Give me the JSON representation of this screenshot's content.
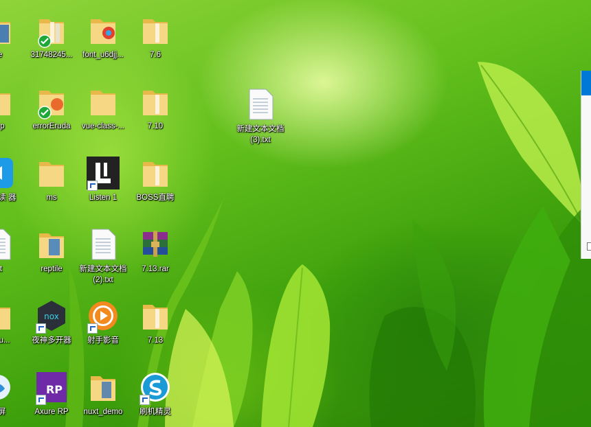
{
  "desktop": {
    "icons": [
      {
        "label": "de",
        "type": "folder-partial"
      },
      {
        "label": "31748245...",
        "type": "folder"
      },
      {
        "label": "font_u6djj...",
        "type": "folder"
      },
      {
        "label": "7.6",
        "type": "folder"
      },
      {
        "label": "app",
        "type": "folder-partial"
      },
      {
        "label": "errorEruda",
        "type": "folder"
      },
      {
        "label": "vue-class-...",
        "type": "folder"
      },
      {
        "label": "7.10",
        "type": "folder"
      },
      {
        "label": "新建文本文档 (3).txt",
        "type": "text-file"
      },
      {
        "label": "DF阅读 器",
        "type": "app-partial"
      },
      {
        "label": "ms",
        "type": "folder"
      },
      {
        "label": "Listen 1",
        "type": "app"
      },
      {
        "label": "BOSS直聘",
        "type": "folder"
      },
      {
        "label": "txt",
        "type": "text-file-partial"
      },
      {
        "label": "reptile",
        "type": "folder"
      },
      {
        "label": "新建文本文档 (2).txt",
        "type": "text-file"
      },
      {
        "label": "7.13.rar",
        "type": "archive"
      },
      {
        "label": "restu...",
        "type": "folder-partial"
      },
      {
        "label": "夜神多开器",
        "type": "app"
      },
      {
        "label": "射手影音",
        "type": "app"
      },
      {
        "label": "7.13",
        "type": "folder"
      },
      {
        "label": "录屏",
        "type": "app-partial"
      },
      {
        "label": "Axure RP",
        "type": "app"
      },
      {
        "label": "nuxt_demo",
        "type": "folder"
      },
      {
        "label": "刷机精灵",
        "type": "app"
      }
    ],
    "icon_names": {
      "folder": "folder-icon",
      "text_file": "text-file-icon",
      "archive": "winrar-archive-icon",
      "sync_badge": "sync-check-icon",
      "shortcut": "shortcut-arrow-icon"
    },
    "colors": {
      "label_text": "#ffffff",
      "folder": "#f3d27a",
      "accent_window": "#0078d7",
      "wallpaper_dark": "#2a7f06",
      "wallpaper_light": "#c8ef72"
    }
  }
}
